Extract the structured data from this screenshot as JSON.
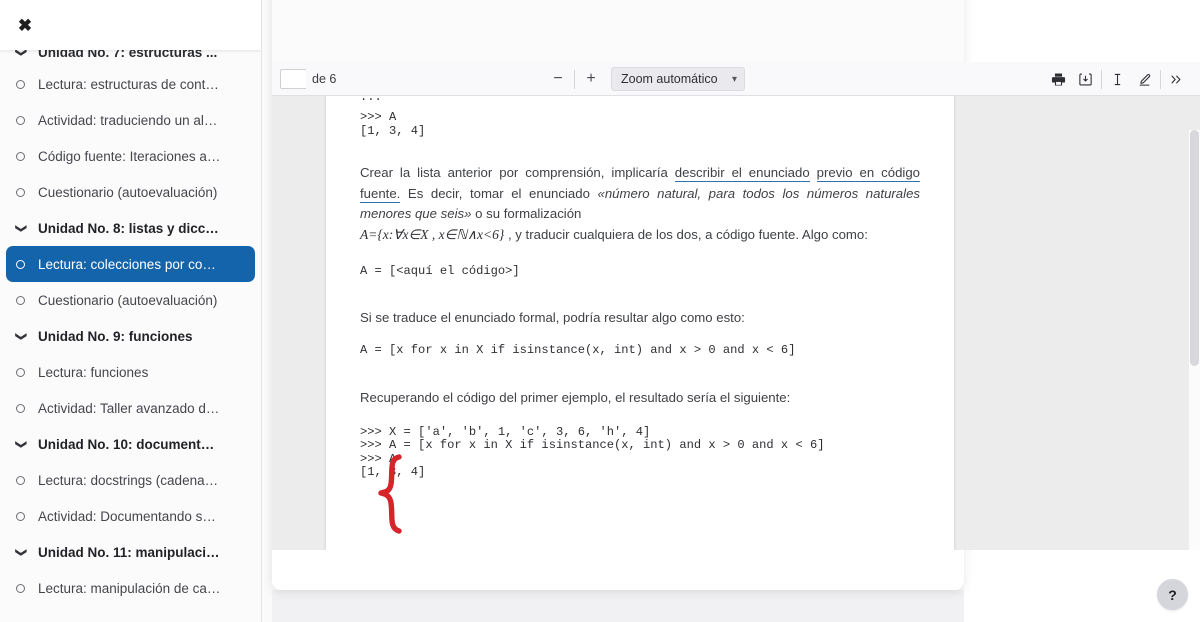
{
  "sidebar": {
    "close_icon": "close-icon",
    "items": [
      {
        "type": "section",
        "label": "Unidad No. 7: estructuras ...",
        "glyph": "chevron-down-icon",
        "active": false,
        "clipped": true
      },
      {
        "type": "item",
        "label": "Lectura: estructuras de cont…",
        "glyph": "circle-icon",
        "active": false
      },
      {
        "type": "item",
        "label": "Actividad: traduciendo un al…",
        "glyph": "circle-icon",
        "active": false
      },
      {
        "type": "item",
        "label": "Código fuente: Iteraciones a…",
        "glyph": "circle-icon",
        "active": false
      },
      {
        "type": "item",
        "label": "Cuestionario (autoevaluación)",
        "glyph": "circle-icon",
        "active": false
      },
      {
        "type": "section",
        "label": "Unidad No. 8: listas y dicc…",
        "glyph": "chevron-down-icon",
        "active": false
      },
      {
        "type": "item",
        "label": "Lectura: colecciones por co…",
        "glyph": "circle-icon",
        "active": true
      },
      {
        "type": "item",
        "label": "Cuestionario (autoevaluación)",
        "glyph": "circle-icon",
        "active": false
      },
      {
        "type": "section",
        "label": "Unidad No. 9: funciones",
        "glyph": "chevron-down-icon",
        "active": false
      },
      {
        "type": "item",
        "label": "Lectura: funciones",
        "glyph": "circle-icon",
        "active": false
      },
      {
        "type": "item",
        "label": "Actividad: Taller avanzado d…",
        "glyph": "circle-icon",
        "active": false
      },
      {
        "type": "section",
        "label": "Unidad No. 10: document…",
        "glyph": "chevron-down-icon",
        "active": false
      },
      {
        "type": "item",
        "label": "Lectura: docstrings (cadena…",
        "glyph": "circle-icon",
        "active": false
      },
      {
        "type": "item",
        "label": "Actividad: Documentando s…",
        "glyph": "circle-icon",
        "active": false
      },
      {
        "type": "section",
        "label": "Unidad No. 11: manipulaci…",
        "glyph": "chevron-down-icon",
        "active": false
      },
      {
        "type": "item",
        "label": "Lectura: manipulación de ca…",
        "glyph": "circle-icon",
        "active": false
      }
    ],
    "active_color": "#1464ac"
  },
  "pdf_toolbar": {
    "page_value": "",
    "page_placeholder": "",
    "page_total": "de 6",
    "zoom_out_label": "−",
    "zoom_in_label": "+",
    "zoom_value": "Zoom automático",
    "zoom_chevron": "chevron-down-icon",
    "icons": [
      {
        "name": "print-icon",
        "glyph": "print"
      },
      {
        "name": "save-icon",
        "glyph": "save"
      },
      {
        "name": "text-select-icon",
        "glyph": "text"
      },
      {
        "name": "highlighter-icon",
        "glyph": "draw"
      },
      {
        "name": "more-tools-icon",
        "glyph": "»"
      }
    ]
  },
  "document": {
    "clipped_top_line": "...",
    "code_block_1": ">>> A\n[1, 3, 4]",
    "para_1_a": "Crear la lista anterior por comprensión, implicaría ",
    "para_1_link_1": "describir el enunciado",
    "para_1_link_2": "previo en código fuente.",
    "para_1_b": " Es decir, tomar el enunciado ",
    "para_1_italic": "«número natural, para todos los números naturales menores que seis»",
    "para_1_c": " o su formalización",
    "formula": "A={x:∀x∈X , x∈ℕ∧x<6}",
    "formula_tail": ", y traducir cualquiera de los dos, a código fuente. Algo como:",
    "code_block_2": "A = [<aquí el código>]",
    "para_2": "Si se traduce el enunciado formal, podría resultar algo como esto:",
    "code_block_3": "A = [x for x in X if isinstance(x, int) and x > 0 and x < 6]",
    "para_3": "Recuperando el código del primer ejemplo, el resultado sería el siguiente:",
    "code_block_4": ">>> X = ['a', 'b', 1, 'c', 3, 6, 'h', 4]\n>>> A = [x for x in X if isinstance(x, int) and x > 0 and x < 6]\n>>> A\n[1, 3, 4]",
    "annotation_color": "#d7232a",
    "link_underline_color": "#2f6fb5"
  },
  "help": {
    "label": "?"
  }
}
